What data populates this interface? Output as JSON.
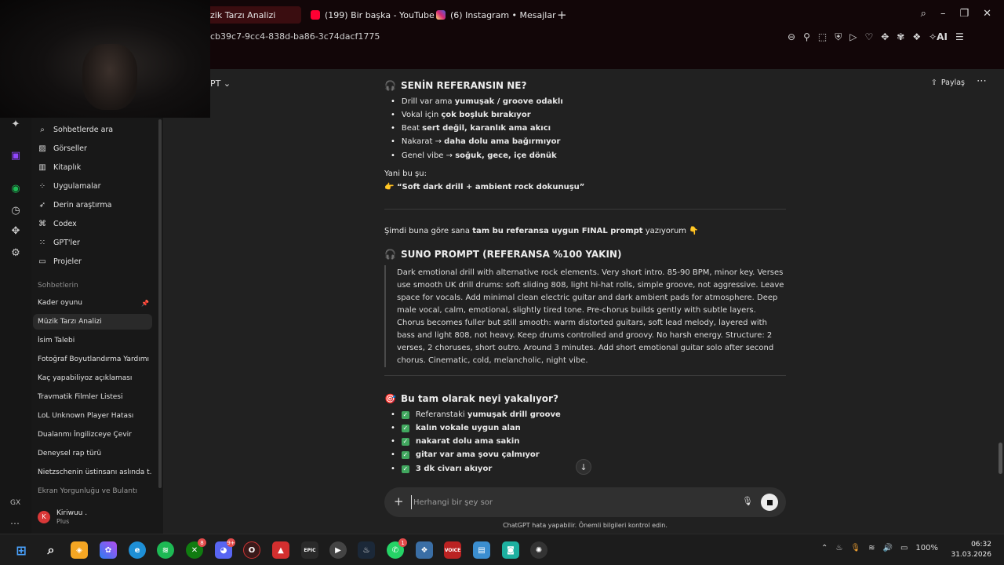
{
  "browser": {
    "tabs": [
      {
        "label": "zik Tarzı Analizi",
        "active": true
      },
      {
        "label": "(199) Bir başka - YouTube"
      },
      {
        "label": "(6) Instagram • Mesajlar"
      }
    ],
    "url": "cb39c7-9cc4-838d-ba86-3c74dacf1775",
    "ai_label": "AI"
  },
  "colors": {
    "accent": "#41a85f",
    "youtube": "#ff0033",
    "instagram": "#d62976",
    "twitch": "#9146ff"
  },
  "sidebar": {
    "nav": [
      {
        "icon": "search-icon",
        "label": "Sohbetlerde ara"
      },
      {
        "icon": "image-icon",
        "label": "Görseller"
      },
      {
        "icon": "library-icon",
        "label": "Kitaplık"
      },
      {
        "icon": "apps-icon",
        "label": "Uygulamalar"
      },
      {
        "icon": "research-icon",
        "label": "Derin araştırma"
      },
      {
        "icon": "codex-icon",
        "label": "Codex"
      },
      {
        "icon": "gpts-icon",
        "label": "GPT'ler"
      },
      {
        "icon": "folder-icon",
        "label": "Projeler"
      }
    ],
    "section_label": "Sohbetlerin",
    "chats": [
      "Kader oyunu",
      "Müzik Tarzı Analizi",
      "İsim Talebi",
      "Fotoğraf Boyutlandırma Yardımı",
      "Kaç yapabiliyoz açıklaması",
      "Travmatik Filmler Listesi",
      "LoL Unknown Player Hatası",
      "Dualanmı İngilizceye Çevir",
      "Deneysel rap türü",
      "Nietzschenin üstinsanı aslında t...",
      "Ekran Yorgunluğu ve Bulantı"
    ],
    "user": {
      "initial": "K",
      "name": "Kiriwuu .",
      "plan": "Plus"
    },
    "gx": "GX"
  },
  "header": {
    "model": "PT",
    "share": "Paylaş"
  },
  "conversation": {
    "ref_heading": "SENİN REFERANSIN NE?",
    "ref_items": [
      {
        "pre": "Drill var ama ",
        "bold": "yumuşak / groove odaklı"
      },
      {
        "pre": "Vokal için ",
        "bold": "çok boşluk bırakıyor"
      },
      {
        "pre": "Beat ",
        "bold": "sert değil, karanlık ama akıcı"
      },
      {
        "pre": "Nakarat → ",
        "bold": "daha dolu ama bağırmıyor"
      },
      {
        "pre": "Genel vibe → ",
        "bold": "soğuk, gece, içe dönük"
      }
    ],
    "summary_label": "Yani bu şu:",
    "summary_quote": "“Soft dark drill + ambient rock dokunuşu”",
    "intro_pre": "Şimdi buna göre sana ",
    "intro_bold": "tam bu referansa uygun FINAL prompt",
    "intro_post": " yazıyorum",
    "suno_heading": "SUNO PROMPT (REFERANSA %100 YAKIN)",
    "suno_prompt": "Dark emotional drill with alternative rock elements. Very short intro. 85-90 BPM, minor key. Verses use smooth UK drill drums: soft sliding 808, light hi-hat rolls, simple groove, not aggressive. Leave space for vocals. Add minimal clean electric guitar and dark ambient pads for atmosphere. Deep male vocal, calm, emotional, slightly tired tone. Pre-chorus builds gently with subtle layers. Chorus becomes fuller but still smooth: warm distorted guitars, soft lead melody, layered with bass and light 808, not heavy. Keep drums controlled and groovy. No harsh energy. Structure: 2 verses, 2 choruses, short outro. Around 3 minutes. Add short emotional guitar solo after second chorus. Cinematic, cold, melancholic, night vibe.",
    "capture_heading": "Bu tam olarak neyi yakalıyor?",
    "capture_items": [
      {
        "pre": "Referanstaki ",
        "bold": "yumuşak drill groove"
      },
      {
        "pre": "",
        "bold": "kalın vokale uygun alan"
      },
      {
        "pre": "",
        "bold": "nakarat dolu ama sakin"
      },
      {
        "pre": "",
        "bold": "gitar var ama şovu çalmıyor"
      },
      {
        "pre": "",
        "bold": "3 dk civarı akıyor"
      }
    ]
  },
  "composer": {
    "placeholder": "Herhangi bir şey sor"
  },
  "disclaimer": "ChatGPT hata yapabilir. Önemli bilgileri kontrol edin.",
  "taskbar": {
    "badges": {
      "xbox": "8",
      "discord": "9+",
      "whatsapp": "1"
    },
    "epic_label": "EPIC",
    "voicemeeter_label": "VOICE",
    "battery": "100%",
    "time": "06:32",
    "date": "31.03.2026"
  }
}
